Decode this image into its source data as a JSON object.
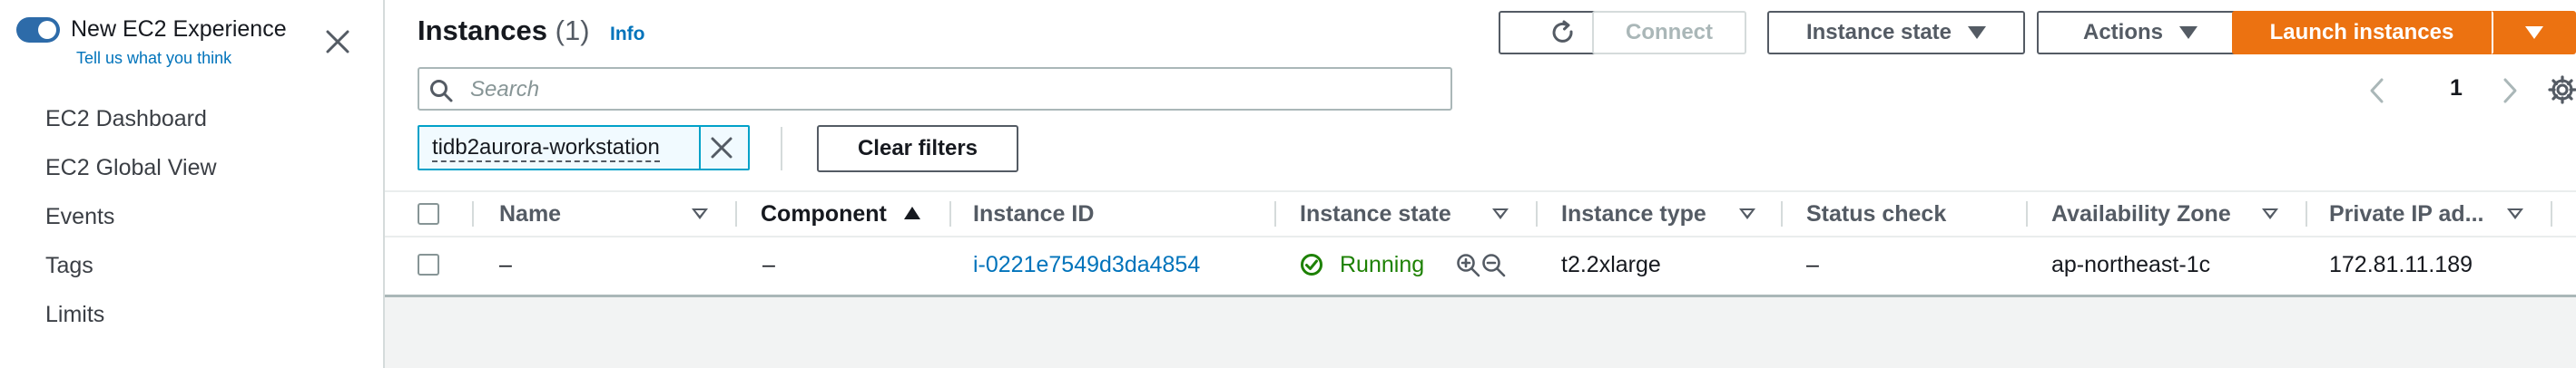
{
  "sidebar": {
    "experience_title": "New EC2 Experience",
    "experience_link": "Tell us what you think",
    "nav_items": [
      "EC2 Dashboard",
      "EC2 Global View",
      "Events",
      "Tags",
      "Limits"
    ]
  },
  "header": {
    "title": "Instances",
    "count": "(1)",
    "info_link": "Info"
  },
  "toolbar": {
    "refresh_icon": "refresh-icon",
    "connect_label": "Connect",
    "instance_state_label": "Instance state",
    "actions_label": "Actions",
    "launch_label": "Launch instances"
  },
  "search": {
    "placeholder": "Search"
  },
  "pagination": {
    "current_page": "1"
  },
  "filters": {
    "token": "tidb2aurora-workstation",
    "clear_label": "Clear filters"
  },
  "table": {
    "columns": [
      "Name",
      "Component",
      "Instance ID",
      "Instance state",
      "Instance type",
      "Status check",
      "Availability Zone",
      "Private IP ad..."
    ],
    "rows": [
      {
        "name": "–",
        "component": "–",
        "instance_id": "i-0221e7549d3da4854",
        "state": "Running",
        "type": "t2.2xlarge",
        "status_check": "–",
        "az": "ap-northeast-1c",
        "private_ip": "172.81.11.189"
      }
    ]
  },
  "colors": {
    "accent": "#ec7211",
    "link": "#0073bb",
    "running": "#1d8102",
    "toggle": "#2d6ba9"
  }
}
